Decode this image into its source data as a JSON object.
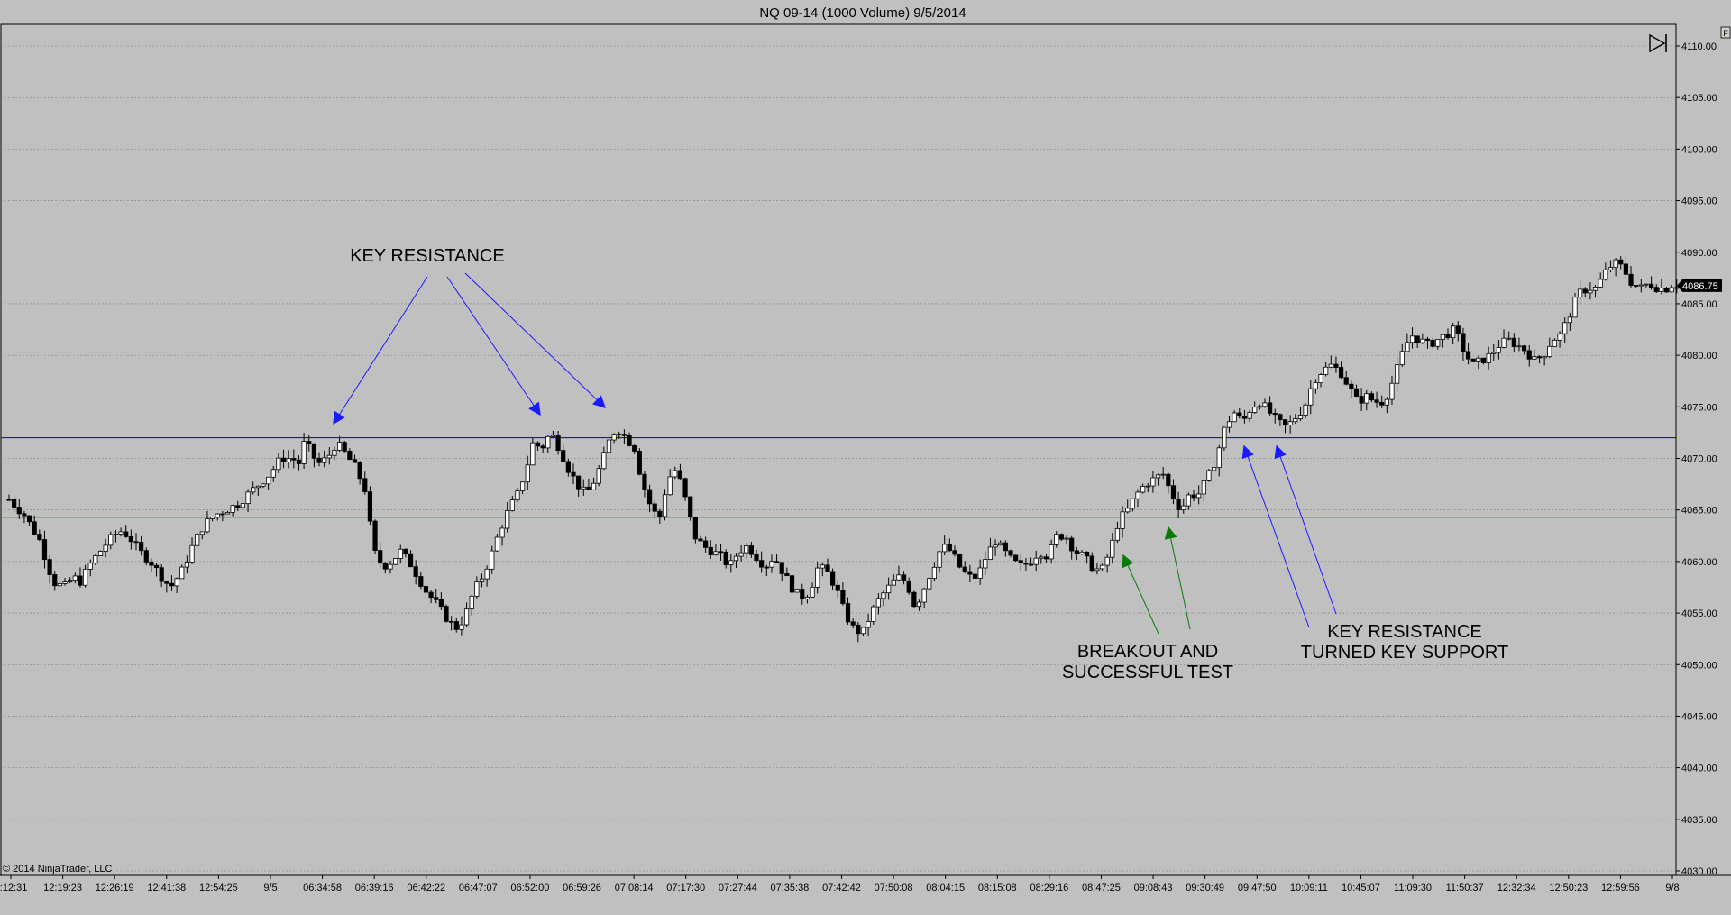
{
  "window": {
    "title": "NQ 09-14 (1000 Volume)  9/5/2014",
    "copyright": "© 2014 NinjaTrader, LLC",
    "corner_label": "F"
  },
  "colors": {
    "background": "#c0c0c0",
    "grid": "#7f7f7f",
    "resistance_line": "#0000cc",
    "support_line": "#006600",
    "blue_arrow": "#1a1aff",
    "green_arrow": "#0a7a0a",
    "up_candle": "#ffffff",
    "down_candle": "#000000",
    "price_tag_bg": "#000000",
    "price_tag_fg": "#ffffff"
  },
  "icons": {
    "scroll_end": "skip-to-end-icon"
  },
  "chart_data": {
    "type": "candlestick",
    "title": "NQ 09-14 (1000 Volume)  9/5/2014",
    "ylim": [
      4030,
      4112
    ],
    "y_ticks": [
      4030,
      4035,
      4040,
      4045,
      4050,
      4055,
      4060,
      4065,
      4070,
      4075,
      4080,
      4085,
      4090,
      4095,
      4100,
      4105,
      4110
    ],
    "y_tick_labels": [
      "4030.00",
      "4035.00",
      "4040.00",
      "4045.00",
      "4050.00",
      "4055.00",
      "4060.00",
      "4065.00",
      "4070.00",
      "4075.00",
      "4080.00",
      "4085.00",
      "4090.00",
      "4095.00",
      "4100.00",
      "4105.00",
      "4110.00"
    ],
    "x_tick_labels": [
      "2:12:31",
      "12:19:23",
      "12:26:19",
      "12:41:38",
      "12:54:25",
      "9/5",
      "06:34:58",
      "06:39:16",
      "06:42:22",
      "06:47:07",
      "06:52:00",
      "06:59:26",
      "07:08:14",
      "07:17:30",
      "07:27:44",
      "07:35:38",
      "07:42:42",
      "07:50:08",
      "08:04:15",
      "08:15:08",
      "08:29:16",
      "08:47:25",
      "09:08:43",
      "09:30:49",
      "09:47:50",
      "10:09:11",
      "10:45:07",
      "11:09:30",
      "11:50:37",
      "12:32:34",
      "12:50:23",
      "12:59:56",
      "9/8"
    ],
    "grid": true,
    "last_price": 4086.75,
    "last_price_label": "4086.75",
    "horizontal_lines": [
      {
        "name": "resistance",
        "value": 4072.0
      },
      {
        "name": "support",
        "value": 4064.3
      }
    ],
    "price_path": [
      [
        0,
        4066.0
      ],
      [
        14,
        4064.5
      ],
      [
        28,
        4062.0
      ],
      [
        40,
        4058.0
      ],
      [
        50,
        4057.5
      ],
      [
        58,
        4058.5
      ],
      [
        64,
        4058.0
      ],
      [
        75,
        4060.0
      ],
      [
        90,
        4062.0
      ],
      [
        100,
        4063.0
      ],
      [
        108,
        4062.5
      ],
      [
        118,
        4061.0
      ],
      [
        128,
        4060.0
      ],
      [
        138,
        4058.5
      ],
      [
        146,
        4057.5
      ],
      [
        156,
        4059.0
      ],
      [
        166,
        4061.5
      ],
      [
        176,
        4063.5
      ],
      [
        186,
        4064.5
      ],
      [
        196,
        4065.0
      ],
      [
        206,
        4065.5
      ],
      [
        216,
        4066.5
      ],
      [
        226,
        4067.5
      ],
      [
        236,
        4068.5
      ],
      [
        246,
        4070.0
      ],
      [
        256,
        4070.0
      ],
      [
        263,
        4069.5
      ],
      [
        268,
        4072.0
      ],
      [
        273,
        4070.5
      ],
      [
        280,
        4069.5
      ],
      [
        288,
        4070.0
      ],
      [
        296,
        4071.5
      ],
      [
        304,
        4070.5
      ],
      [
        314,
        4069.0
      ],
      [
        322,
        4067.0
      ],
      [
        330,
        4061.0
      ],
      [
        338,
        4059.5
      ],
      [
        346,
        4060.0
      ],
      [
        354,
        4061.0
      ],
      [
        362,
        4060.0
      ],
      [
        370,
        4058.5
      ],
      [
        378,
        4057.0
      ],
      [
        386,
        4056.0
      ],
      [
        396,
        4054.5
      ],
      [
        404,
        4053.5
      ],
      [
        412,
        4054.5
      ],
      [
        420,
        4057.0
      ],
      [
        428,
        4058.5
      ],
      [
        436,
        4060.5
      ],
      [
        444,
        4063.0
      ],
      [
        452,
        4065.0
      ],
      [
        460,
        4066.5
      ],
      [
        468,
        4069.0
      ],
      [
        474,
        4071.5
      ],
      [
        482,
        4071.0
      ],
      [
        490,
        4072.5
      ],
      [
        498,
        4071.0
      ],
      [
        506,
        4069.0
      ],
      [
        514,
        4067.5
      ],
      [
        522,
        4066.5
      ],
      [
        528,
        4067.5
      ],
      [
        536,
        4069.5
      ],
      [
        544,
        4072.0
      ],
      [
        550,
        4073.0
      ],
      [
        558,
        4072.0
      ],
      [
        566,
        4071.0
      ],
      [
        572,
        4068.0
      ],
      [
        580,
        4065.5
      ],
      [
        588,
        4064.0
      ],
      [
        596,
        4068.0
      ],
      [
        604,
        4069.0
      ],
      [
        612,
        4066.0
      ],
      [
        620,
        4062.5
      ],
      [
        628,
        4061.5
      ],
      [
        636,
        4061.0
      ],
      [
        644,
        4060.5
      ],
      [
        652,
        4059.5
      ],
      [
        660,
        4061.0
      ],
      [
        668,
        4061.5
      ],
      [
        676,
        4060.5
      ],
      [
        684,
        4059.5
      ],
      [
        692,
        4060.5
      ],
      [
        700,
        4059.0
      ],
      [
        708,
        4057.5
      ],
      [
        716,
        4056.5
      ],
      [
        724,
        4057.0
      ],
      [
        732,
        4059.5
      ],
      [
        740,
        4059.0
      ],
      [
        748,
        4057.5
      ],
      [
        756,
        4055.0
      ],
      [
        764,
        4053.5
      ],
      [
        772,
        4053.0
      ],
      [
        780,
        4055.0
      ],
      [
        788,
        4056.5
      ],
      [
        796,
        4057.5
      ],
      [
        804,
        4058.5
      ],
      [
        812,
        4058.0
      ],
      [
        820,
        4055.5
      ],
      [
        828,
        4057.5
      ],
      [
        836,
        4059.5
      ],
      [
        844,
        4061.5
      ],
      [
        852,
        4061.0
      ],
      [
        860,
        4059.5
      ],
      [
        868,
        4058.5
      ],
      [
        876,
        4058.5
      ],
      [
        884,
        4060.5
      ],
      [
        892,
        4062.0
      ],
      [
        900,
        4061.0
      ],
      [
        908,
        4060.0
      ],
      [
        916,
        4059.5
      ],
      [
        924,
        4060.0
      ],
      [
        932,
        4061.0
      ],
      [
        940,
        4060.5
      ],
      [
        948,
        4062.5
      ],
      [
        956,
        4062.5
      ],
      [
        964,
        4061.0
      ],
      [
        972,
        4060.5
      ],
      [
        980,
        4059.5
      ],
      [
        988,
        4059.0
      ],
      [
        996,
        4061.0
      ],
      [
        1004,
        4064.0
      ],
      [
        1012,
        4065.0
      ],
      [
        1020,
        4066.5
      ],
      [
        1028,
        4067.5
      ],
      [
        1036,
        4068.0
      ],
      [
        1044,
        4068.5
      ],
      [
        1052,
        4066.5
      ],
      [
        1060,
        4065.0
      ],
      [
        1068,
        4066.5
      ],
      [
        1076,
        4066.5
      ],
      [
        1084,
        4068.0
      ],
      [
        1092,
        4070.0
      ],
      [
        1100,
        4073.0
      ],
      [
        1108,
        4074.5
      ],
      [
        1116,
        4073.5
      ],
      [
        1124,
        4075.0
      ],
      [
        1132,
        4075.5
      ],
      [
        1140,
        4074.5
      ],
      [
        1148,
        4073.5
      ],
      [
        1156,
        4073.0
      ],
      [
        1164,
        4074.0
      ],
      [
        1172,
        4075.0
      ],
      [
        1180,
        4077.5
      ],
      [
        1188,
        4078.5
      ],
      [
        1196,
        4079.0
      ],
      [
        1204,
        4078.5
      ],
      [
        1212,
        4077.0
      ],
      [
        1220,
        4075.5
      ],
      [
        1228,
        4076.0
      ],
      [
        1236,
        4075.5
      ],
      [
        1244,
        4075.5
      ],
      [
        1252,
        4077.5
      ],
      [
        1260,
        4080.0
      ],
      [
        1268,
        4082.0
      ],
      [
        1276,
        4081.5
      ],
      [
        1284,
        4081.0
      ],
      [
        1292,
        4081.5
      ],
      [
        1300,
        4082.0
      ],
      [
        1308,
        4082.5
      ],
      [
        1316,
        4080.5
      ],
      [
        1324,
        4079.0
      ],
      [
        1332,
        4079.5
      ],
      [
        1340,
        4080.0
      ],
      [
        1348,
        4081.0
      ],
      [
        1356,
        4081.5
      ],
      [
        1364,
        4081.0
      ],
      [
        1372,
        4080.5
      ],
      [
        1380,
        4079.5
      ],
      [
        1388,
        4080.0
      ],
      [
        1396,
        4081.5
      ],
      [
        1404,
        4082.0
      ],
      [
        1412,
        4084.0
      ],
      [
        1420,
        4086.0
      ],
      [
        1428,
        4086.5
      ],
      [
        1436,
        4086.5
      ],
      [
        1444,
        4088.0
      ],
      [
        1452,
        4089.0
      ],
      [
        1460,
        4088.5
      ],
      [
        1468,
        4087.0
      ],
      [
        1476,
        4086.5
      ],
      [
        1484,
        4087.0
      ],
      [
        1492,
        4086.5
      ],
      [
        1500,
        4086.5
      ],
      [
        1506,
        4087.0
      ],
      [
        1509,
        4086.75
      ]
    ]
  },
  "annotations": [
    {
      "id": "key_resistance",
      "lines": [
        "KEY RESISTANCE"
      ]
    },
    {
      "id": "breakout",
      "lines": [
        "BREAKOUT AND",
        "SUCCESSFUL TEST"
      ]
    },
    {
      "id": "turned_support",
      "lines": [
        "KEY RESISTANCE",
        "TURNED KEY SUPPORT"
      ]
    }
  ]
}
